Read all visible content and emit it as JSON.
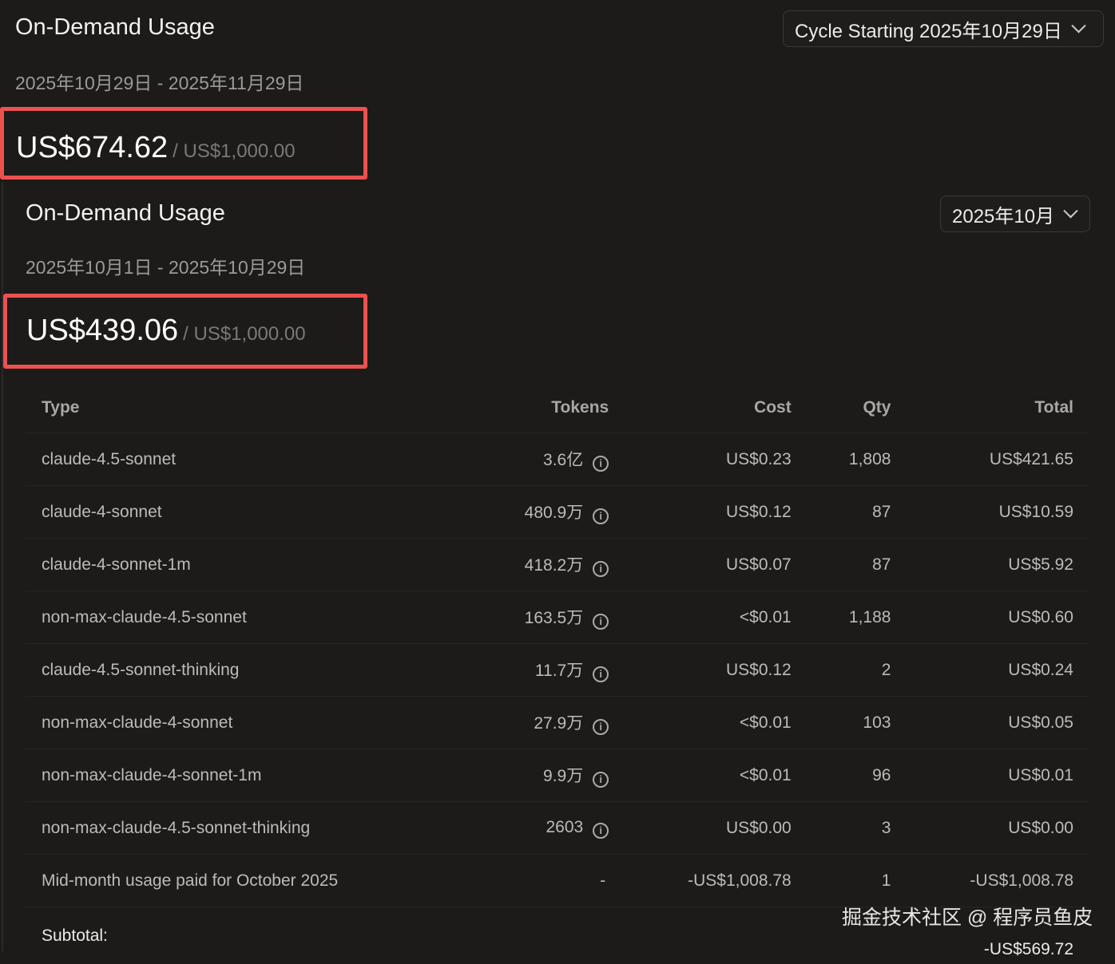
{
  "cycle": {
    "title": "On-Demand Usage",
    "range": "2025年10月29日 - 2025年11月29日",
    "amount": "US$674.62",
    "limit": "/ US$1,000.00",
    "dropdown": "Cycle Starting 2025年10月29日"
  },
  "month": {
    "title": "On-Demand Usage",
    "range": "2025年10月1日 - 2025年10月29日",
    "amount": "US$439.06",
    "limit": "/ US$1,000.00",
    "dropdown": "2025年10月"
  },
  "table": {
    "headers": [
      "Type",
      "Tokens",
      "Cost",
      "Qty",
      "Total"
    ],
    "rows": [
      {
        "type": "claude-4.5-sonnet",
        "tokens": "3.6亿",
        "cost": "US$0.23",
        "qty": "1,808",
        "total": "US$421.65"
      },
      {
        "type": "claude-4-sonnet",
        "tokens": "480.9万",
        "cost": "US$0.12",
        "qty": "87",
        "total": "US$10.59"
      },
      {
        "type": "claude-4-sonnet-1m",
        "tokens": "418.2万",
        "cost": "US$0.07",
        "qty": "87",
        "total": "US$5.92"
      },
      {
        "type": "non-max-claude-4.5-sonnet",
        "tokens": "163.5万",
        "cost": "<$0.01",
        "qty": "1,188",
        "total": "US$0.60"
      },
      {
        "type": "claude-4.5-sonnet-thinking",
        "tokens": "11.7万",
        "cost": "US$0.12",
        "qty": "2",
        "total": "US$0.24"
      },
      {
        "type": "non-max-claude-4-sonnet",
        "tokens": "27.9万",
        "cost": "<$0.01",
        "qty": "103",
        "total": "US$0.05"
      },
      {
        "type": "non-max-claude-4-sonnet-1m",
        "tokens": "9.9万",
        "cost": "<$0.01",
        "qty": "96",
        "total": "US$0.01"
      },
      {
        "type": "non-max-claude-4.5-sonnet-thinking",
        "tokens": "2603",
        "cost": "US$0.00",
        "qty": "3",
        "total": "US$0.00"
      }
    ],
    "midmonth": {
      "type": "Mid-month usage paid for October 2025",
      "tokens": "-",
      "cost": "-US$1,008.78",
      "qty": "1",
      "total": "-US$1,008.78"
    },
    "subtotal_label": "Subtotal:",
    "subtotal_value": "-US$569.72"
  },
  "watermark": "掘金技术社区 @ 程序员鱼皮"
}
